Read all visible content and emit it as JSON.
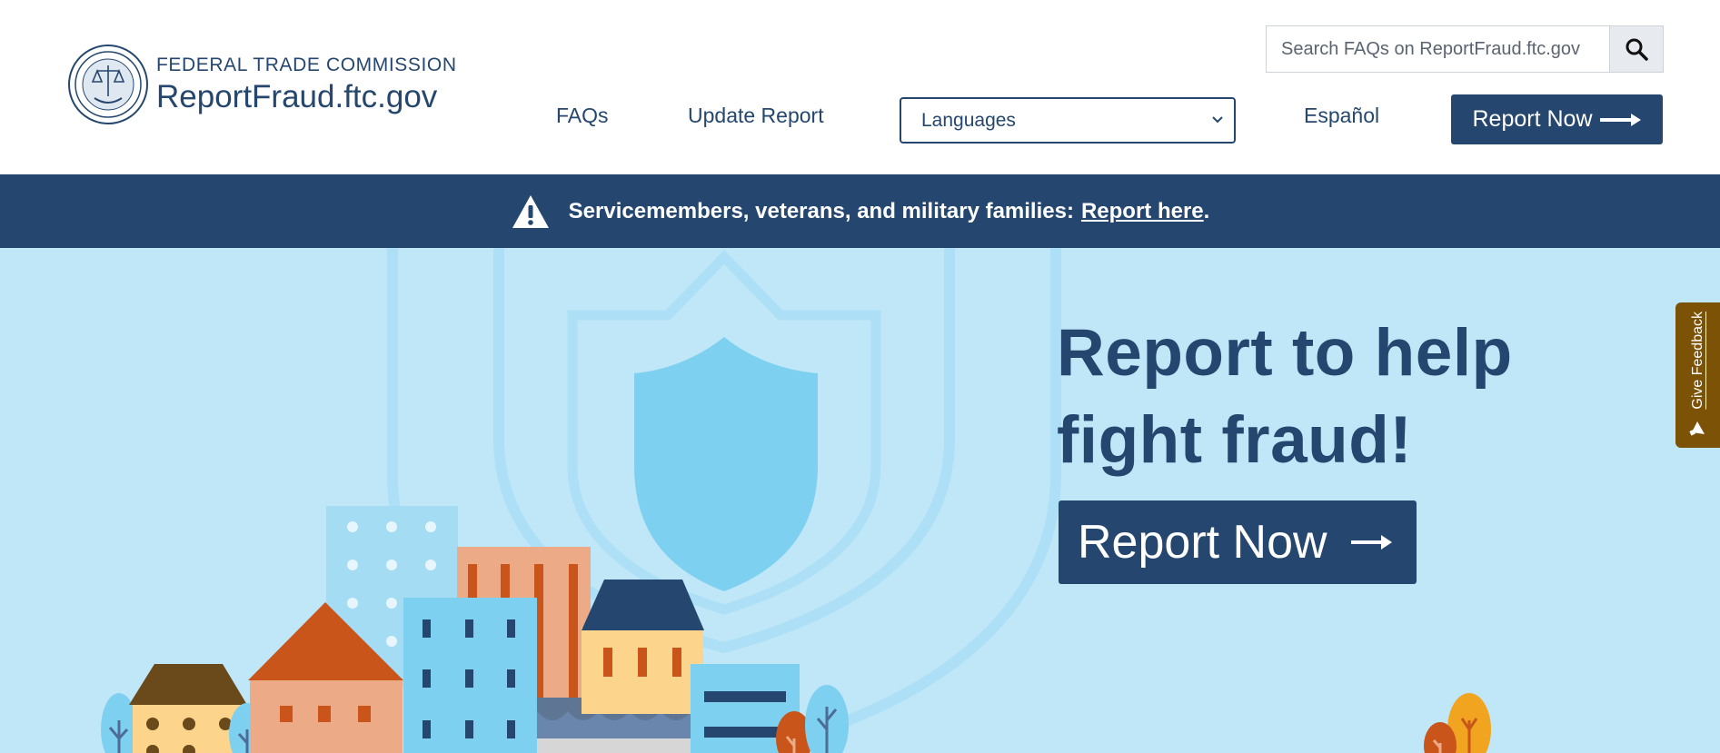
{
  "header": {
    "agency": "FEDERAL TRADE COMMISSION",
    "site_name": "ReportFraud.ftc.gov",
    "search": {
      "placeholder": "Search FAQs on ReportFraud.ftc.gov",
      "value": ""
    },
    "nav": {
      "faqs": "FAQs",
      "update_report": "Update Report",
      "espanol": "Español"
    },
    "languages": {
      "selected": "Languages"
    },
    "report_button": "Report Now"
  },
  "banner": {
    "text": "Servicemembers, veterans, and military families:",
    "link": "Report here",
    "suffix": "."
  },
  "hero": {
    "title_line1": "Report to help",
    "title_line2": "fight fraud!",
    "button": "Report Now"
  },
  "feedback": {
    "label": "Give Feedback"
  },
  "icons": {
    "seal": "ftc-seal-icon",
    "search": "search-icon",
    "chevron": "chevron-down-icon",
    "arrow": "arrow-right-icon",
    "warning": "warning-icon",
    "megaphone": "megaphone-icon"
  },
  "colors": {
    "navy": "#25476f",
    "hero_bg": "#c0e7f7",
    "feedback_bg": "#7b5206"
  }
}
